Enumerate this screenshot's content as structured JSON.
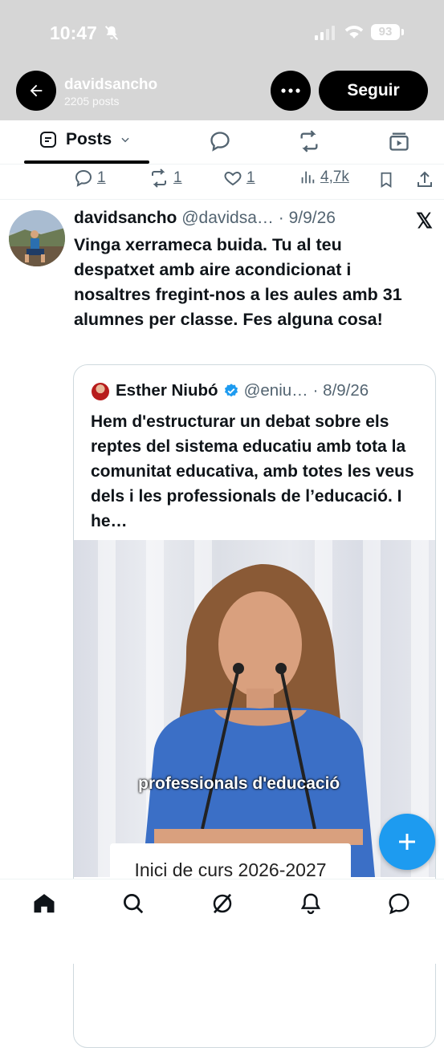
{
  "status_bar": {
    "time": "10:47",
    "battery": "93"
  },
  "header": {
    "name": "davidsancho",
    "posts_count": "2205 posts",
    "follow_label": "Seguir"
  },
  "tabs": {
    "active_label": "Posts"
  },
  "prev_tweet_actions": {
    "replies": "1",
    "reposts": "1",
    "likes": "1",
    "views": "4,7k"
  },
  "tweet": {
    "name": "davidsancho",
    "handle": "@davidsa…",
    "date": "· 9/9/26",
    "text": "Vinga xerrameca buida. Tu al teu despatxet amb aire acondicionat i nosaltres fregint-nos a les aules amb 31 alumnes per classe. Fes alguna cosa!",
    "quote": {
      "name": "Esther Niubó",
      "handle": "@eniu…",
      "date": "· 8/9/26",
      "text": "Hem d'estructurar un debat sobre els reptes del sistema educatiu amb tota la comunitat educativa, amb totes les veus dels i les professionals de l’educació. I he…",
      "video_caption": "professionals d'educació",
      "video_lower_third": "Inici de curs 2026-2027"
    }
  },
  "colors": {
    "accent": "#1d9bf0",
    "header_bg": "#d6d6d6",
    "text_secondary": "#536471",
    "verified": "#1d9bf0"
  }
}
